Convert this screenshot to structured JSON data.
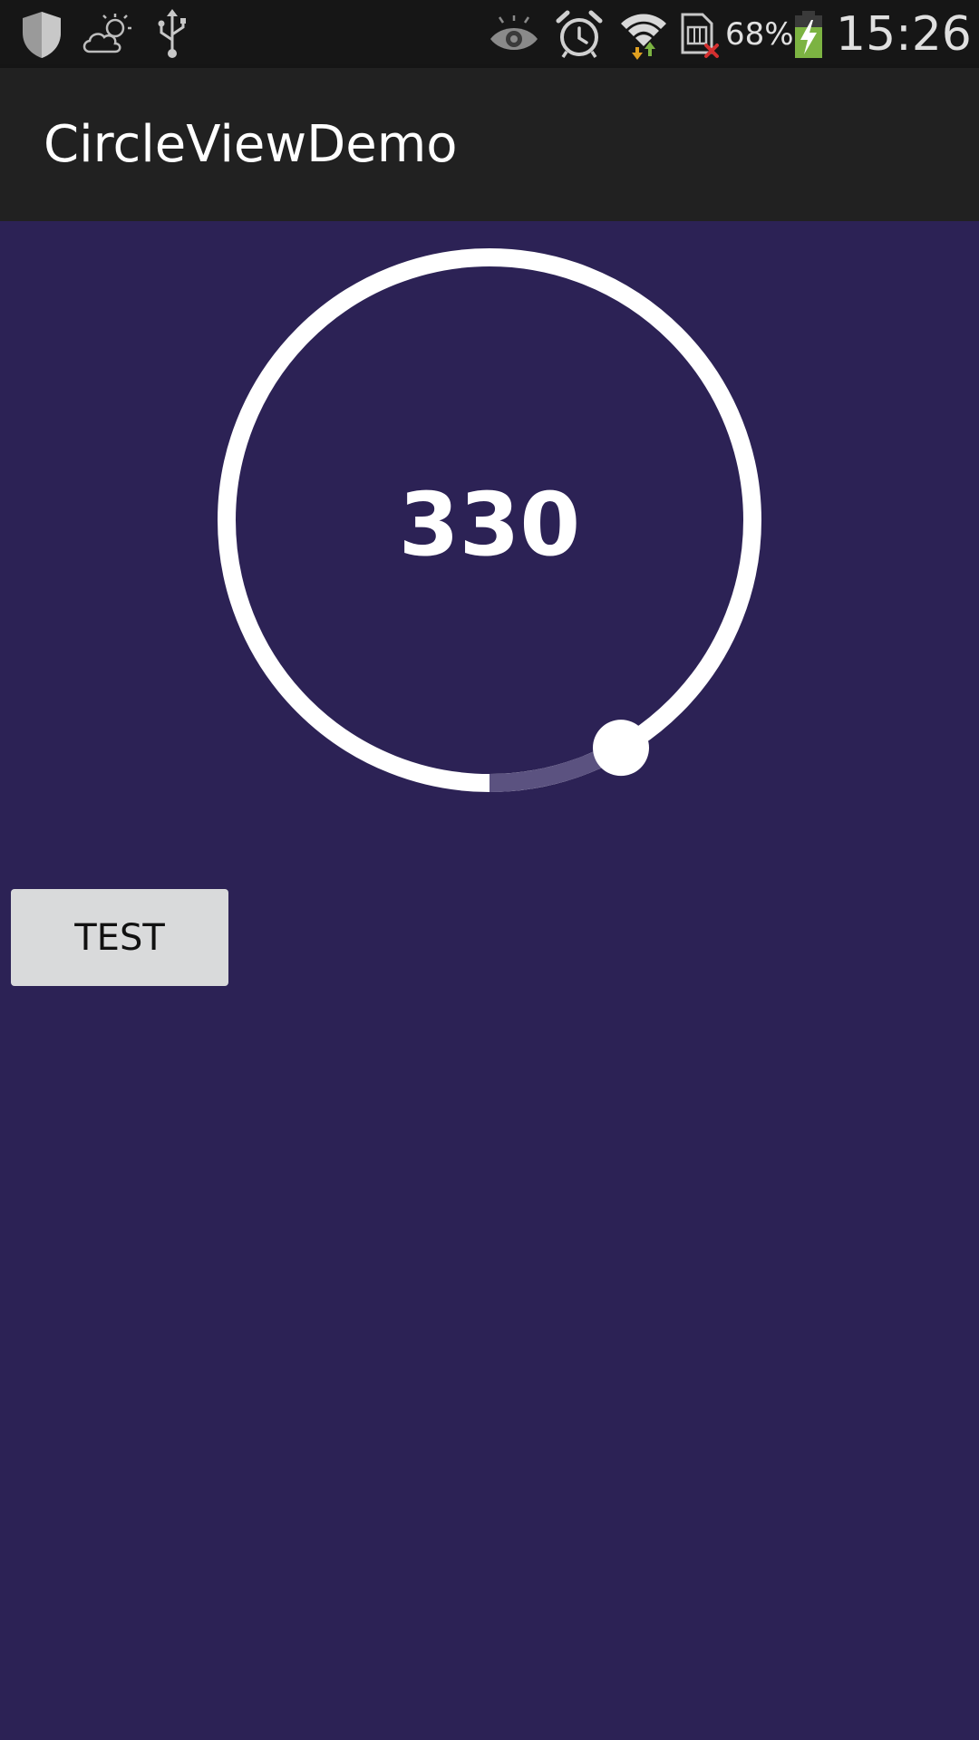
{
  "status_bar": {
    "icons": [
      "shield-icon",
      "weather-partly-cloudy-icon",
      "usb-icon",
      "eye-icon",
      "alarm-icon",
      "wifi-icon",
      "sim-error-icon",
      "battery-charging-icon"
    ],
    "battery_percent": "68%",
    "time": "15:26",
    "colors": {
      "background": "#161616",
      "battery_fill": "#7cb342",
      "sim_error": "#d32f2f"
    }
  },
  "action_bar": {
    "title": "CircleViewDemo"
  },
  "circle_view": {
    "value": "330",
    "level_degrees": 330,
    "colors": {
      "ring": "#ffffff",
      "remaining_arc": "#5b5280",
      "thumb": "#ffffff"
    }
  },
  "test_button": {
    "label": "TEST"
  },
  "theme": {
    "background": "#2c2255",
    "action_bar": "#212121"
  }
}
